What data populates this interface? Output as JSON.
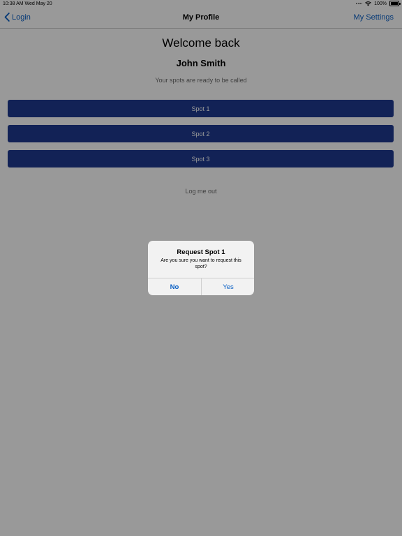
{
  "status_bar": {
    "time_date": "10:38 AM   Wed May 20",
    "battery": "100%",
    "icons": [
      "signal-icon",
      "wifi-icon",
      "battery-icon"
    ]
  },
  "nav": {
    "back_label": "Login",
    "title": "My Profile",
    "settings_label": "My Settings"
  },
  "content": {
    "welcome": "Welcome back",
    "name": "John Smith",
    "subtitle": "Your spots are ready to be called",
    "spots": [
      "Spot 1",
      "Spot 2",
      "Spot 3"
    ],
    "logout": "Log me out"
  },
  "alert": {
    "title": "Request Spot 1",
    "message": "Are you sure you want to request this spot?",
    "no": "No",
    "yes": "Yes"
  },
  "colors": {
    "accent": "#0a60c5",
    "button_bg": "#1e3a8f",
    "overlay": "rgba(0,0,0,0.40)"
  }
}
